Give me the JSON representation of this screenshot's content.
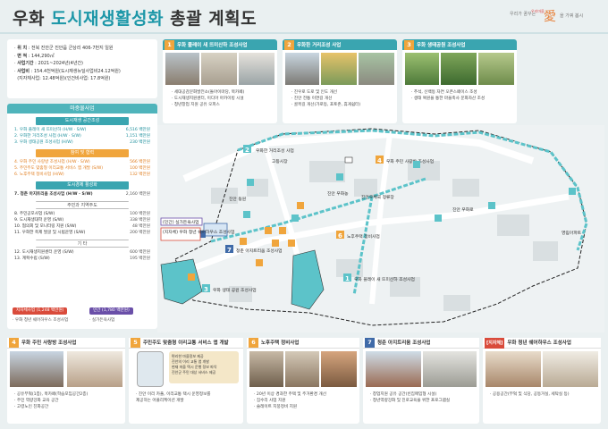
{
  "header": {
    "title_a": "우화",
    "title_b": "도시재생활성화",
    "title_c": "총괄 계획도",
    "slogan": [
      "우리가 꿈꾸는",
      "愛",
      "우리마을",
      "을 가꿔 봅시"
    ]
  },
  "overview": {
    "items": [
      {
        "label": "위 치",
        "value": "전북 진안군 진안읍 군상리 406-7번지 일원"
      },
      {
        "label": "면 적",
        "value": "144,290㎡"
      },
      {
        "label": "사업기간",
        "value": "2021~2024년(4년간)"
      },
      {
        "label": "사업비",
        "value": "154.4천억원(도시재생뉴딜사업비24.12억원)"
      },
      {
        "label": "",
        "value": "(지자체사업: 12.48억원)(인건비사업: 17.8억원)"
      }
    ]
  },
  "plan": {
    "title": "마중물사업",
    "sections": [
      {
        "title": "도시재생 공간조성",
        "style": "teal",
        "rows": [
          {
            "l": "1. 우화 플레이 새 뜨미산하 (H/W · S/W)",
            "r": "6,516 백만원",
            "c": "teal"
          },
          {
            "l": "2. 우화한 거리조성 사업 (H/W · S/W)",
            "r": "1,151 백만원",
            "c": "teal"
          },
          {
            "l": "3. 우화 생태공원 조성사업 (H/W)",
            "r": "230 백만원",
            "c": "teal"
          }
        ]
      },
      {
        "title": "참여 및 협력",
        "style": "orange",
        "rows": [
          {
            "l": "4. 우화 주민 사랑방 조성사업 (H/W · S/W)",
            "r": "566 백만원",
            "c": "orange"
          },
          {
            "l": "5. 주민주도 맞춤형 이리교통 서비스 앱 개발 (S/W)",
            "r": "100 백만원",
            "c": "orange"
          },
          {
            "l": "6. 노후주택 정비사업 (H/W)",
            "r": "132 백만원",
            "c": "orange"
          }
        ]
      },
      {
        "title": "도시경제 활성화",
        "style": "teal",
        "rows": [
          {
            "l": "7. 청춘 아지트리움 조성사업 (H/W · S/W)",
            "r": "2,160 백만원",
            "c": "dark"
          }
        ]
      },
      {
        "title": "주민과 지역주도",
        "style": "gray",
        "rows": [
          {
            "l": "8. 주민공모사업 (S/W)",
            "r": "100 백만원",
            "c": ""
          },
          {
            "l": "9. 도시재생대학 운영 (S/W)",
            "r": "338 백만원",
            "c": ""
          },
          {
            "l": "10. 협의회 및 모니터링 지원 (S/W)",
            "r": "48 백만원",
            "c": ""
          },
          {
            "l": "11. 우화한 축제 발굴 및 시범운영 (S/W)",
            "r": "200 백만원",
            "c": ""
          }
        ]
      },
      {
        "title": "기 타",
        "style": "gray",
        "rows": [
          {
            "l": "12. 도시재생지원센터 운영 (S/W)",
            "r": "600 백만원",
            "c": ""
          },
          {
            "l": "13. 계획수립 (S/W)",
            "r": "195 백만원",
            "c": ""
          }
        ]
      }
    ]
  },
  "badges": {
    "left": {
      "label": "지자체사업 (1,248 백만원)",
      "sub": "· 우화 청년 쉐어하우스 조성사업",
      "color": "#d94b3b"
    },
    "right": {
      "label": "민간 (1,780 백만원)",
      "sub": "· 실가든육사업",
      "color": "#6a4fa8"
    }
  },
  "projects_top": [
    {
      "num": "1",
      "title": "우화 플레이 새 뜨미산하 조성사업",
      "desc": [
        "· 세대공감문화발전소(돌아이마당, 북카페)",
        "· 도시재생지원센터, 이디아 아카이빙 시설",
        "· 청년창업 지원 공유 오피스"
      ]
    },
    {
      "num": "2",
      "title": "우화한 거리조성 사업",
      "desc": [
        "· 진우로 도로 및 인도 개선",
        "· 진안 전통 이면길 개선",
        "· 골목길 개선(가로등, 포토존, 휴게쉼터)"
      ]
    },
    {
      "num": "3",
      "title": "우화 생태공원 조성사업",
      "desc": [
        "· 추석, 신백동 자연 오픈스페이스 조성",
        "· 생태 복원을 통한 마을축사 문화자산 조성"
      ]
    }
  ],
  "map": {
    "labels": [
      {
        "num": "2",
        "text": "우화한 거리조성 사업"
      },
      {
        "num": "4",
        "text": "우화 주민 사랑방 조성사업"
      },
      {
        "num": "3",
        "text": "우화 생태 공원 조성사업"
      },
      {
        "num": "6",
        "text": "노후주택 정비사업"
      },
      {
        "num": "1",
        "text": "우화 플레이 새 뜨미산하 조성사업"
      },
      {
        "num": "7",
        "text": "청춘 아지트리움 조성사업"
      }
    ],
    "places": [
      "고등시장",
      "진안 동원",
      "진안 우화농",
      "진안우체국 정류장",
      "영림아파트",
      "진안 우화로"
    ],
    "popups": [
      "(민간) 실가든육사업",
      "(지자체) 우화 청년 쉐어하우스 조성사업"
    ]
  },
  "projects_bottom": [
    {
      "num": "4",
      "title": "우화 주민 사랑방 조성사업",
      "desc": [
        "· 공유부엌(1층), 북카페(학습모임공간2층)",
        "· 주민 역량강화 교육 공간",
        "· 고령노인 친화공간"
      ]
    },
    {
      "num": "5",
      "title": "주민주도 맞춤형 이리교통 서비스 앱 개발",
      "desc": [
        "· 진안 이리 카풀, 이리교통 택시 운영정보를",
        "  제공하는 어플리케이션 개발"
      ],
      "note": [
        "편리한 마을정보 제공",
        "진안의 이리 교통 앱 개발",
        "현재 마을 택시 운행 정보 파악",
        "진안군 주민 대상 서비스 제공"
      ]
    },
    {
      "num": "6",
      "title": "노후주택 정비사업",
      "desc": [
        "· 20년 이상 경과한 주택 및 주거환경 개선",
        "· 집수리 사업 지원",
        "· 슬레이트 지붕정비 지원"
      ]
    },
    {
      "num": "7",
      "title": "청춘 아지트리움 조성사업",
      "desc": [
        "· 창업지원 공유 공간(빈집매입형 시설)",
        "· 청년역량강화 및 진로교육을 위한 프로그램실"
      ]
    },
    {
      "num": "",
      "tag": "[지자체]",
      "title": "우화 청년 쉐어하우스 조성사업",
      "desc": [
        "· 공용공간(부엌 및 식당, 공동거실, 세탁실 등)"
      ]
    }
  ],
  "colors": {
    "teal": "#3aa5b0",
    "orange": "#f0a53c",
    "blue": "#3f6aa8"
  }
}
